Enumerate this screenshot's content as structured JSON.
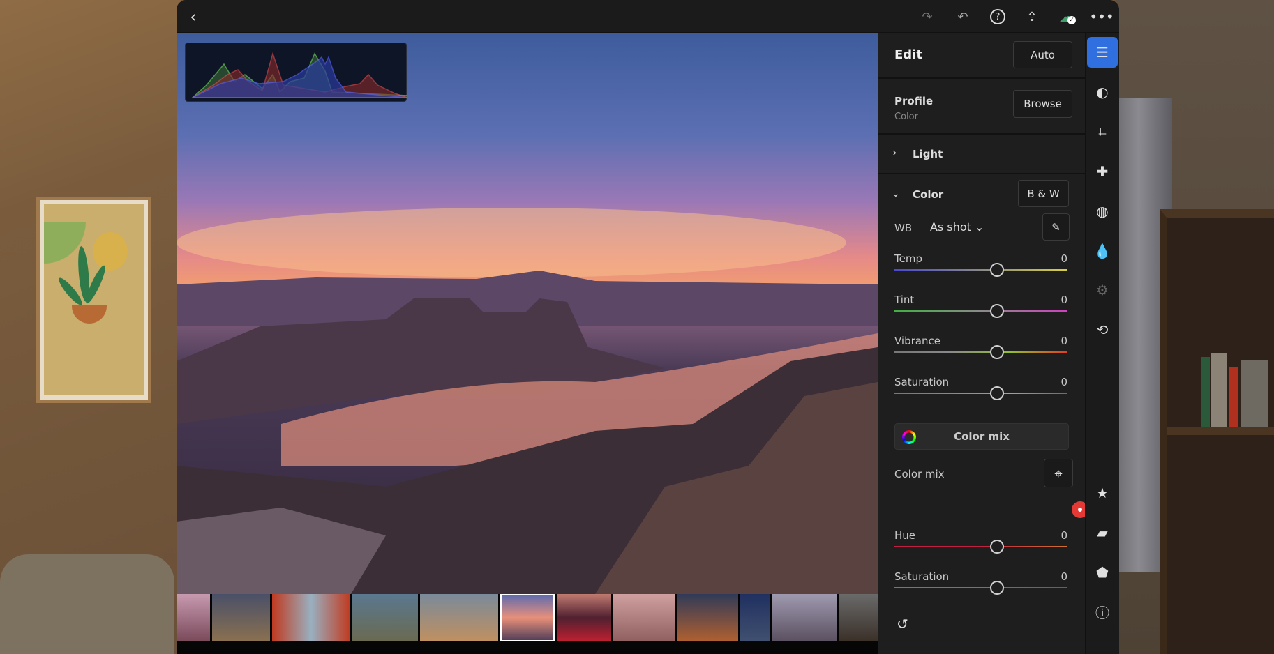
{
  "topbar": {
    "icons": [
      "back-icon",
      "redo-icon",
      "undo-icon",
      "help-icon",
      "share-icon",
      "cloud-synced-icon",
      "more-icon"
    ]
  },
  "panel": {
    "title": "Edit",
    "auto_label": "Auto",
    "profile": {
      "label": "Profile",
      "value": "Color",
      "browse_label": "Browse"
    },
    "light": {
      "label": "Light"
    },
    "color": {
      "label": "Color",
      "bw_label": "B & W",
      "wb_label": "WB",
      "wb_value": "As shot",
      "sliders": [
        {
          "label": "Temp",
          "value": "0",
          "gradient": [
            "#4a4ad0",
            "#8a8a8a",
            "#d8d040"
          ]
        },
        {
          "label": "Tint",
          "value": "0",
          "gradient": [
            "#40b040",
            "#8a8a8a",
            "#d040c0"
          ]
        },
        {
          "label": "Vibrance",
          "value": "0",
          "gradient": [
            "#777",
            "#8a8a8a",
            "#90c030",
            "#e04020"
          ]
        },
        {
          "label": "Saturation",
          "value": "0",
          "gradient": [
            "#777",
            "#8a8a8a",
            "#90c030",
            "#e04020"
          ]
        }
      ]
    },
    "color_mix": {
      "button_label": "Color mix",
      "label": "Color mix",
      "swatches": [
        "#e53935",
        "#e8873a",
        "#e8e030",
        "#50a850",
        "#40c8d8",
        "#3a4aa0",
        "#9030e0",
        "#e030e0"
      ],
      "selected": 0,
      "sliders": [
        {
          "label": "Hue",
          "value": "0",
          "gradient": [
            "#c02040",
            "#c02040",
            "#d07030"
          ]
        },
        {
          "label": "Saturation",
          "value": "0",
          "gradient": [
            "#777",
            "#a06060",
            "#d03030"
          ]
        }
      ]
    }
  },
  "rail": {
    "icons": [
      "edit-sliders-icon",
      "masking-icon",
      "crop-icon",
      "healing-icon",
      "vignette-icon",
      "blur-drop-icon",
      "presets-icon",
      "versions-icon",
      "rating-star-icon",
      "comments-icon",
      "tags-icon",
      "info-icon"
    ],
    "active": 0,
    "accent": "#2f6fe0"
  },
  "filmstrip": {
    "count": 12,
    "selected": 5
  }
}
